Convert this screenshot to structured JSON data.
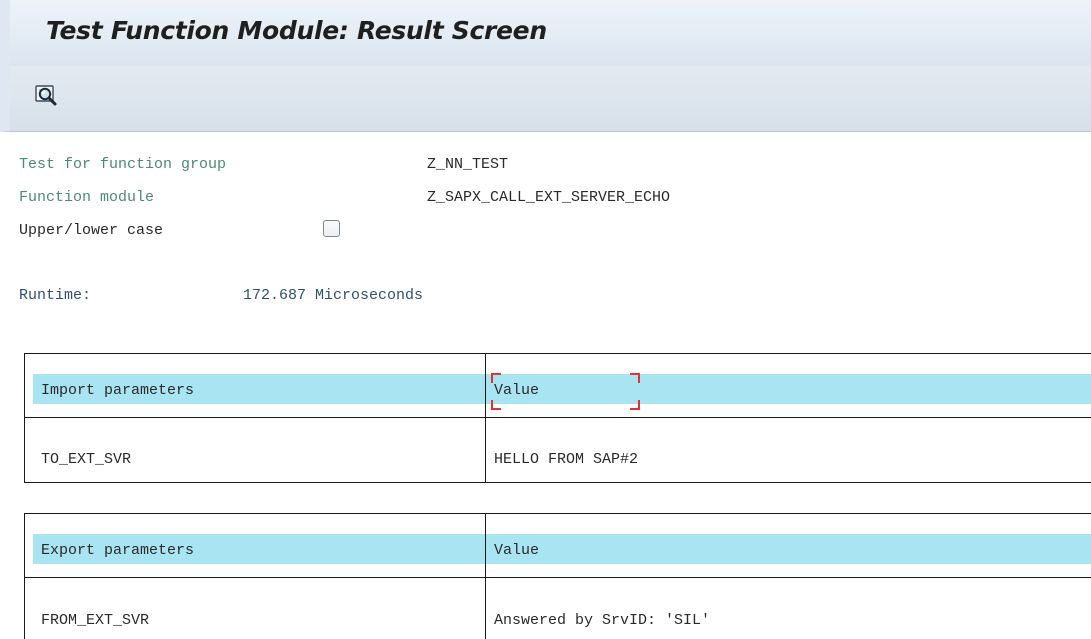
{
  "window": {
    "title": "Test Function Module: Result Screen"
  },
  "toolbar": {
    "buttons": [
      {
        "icon": "find-icon",
        "tooltip": ""
      }
    ]
  },
  "header": {
    "function_group_label": "Test for function group",
    "function_group_value": "Z_NN_TEST",
    "function_module_label": "Function module",
    "function_module_value": "Z_SAPX_CALL_EXT_SERVER_ECHO",
    "case_label": "Upper/lower case",
    "case_checked": false,
    "runtime_label": "Runtime:",
    "runtime_value": "172.687 Microseconds"
  },
  "import_table": {
    "col_param": "Import parameters",
    "col_value": "Value",
    "rows": [
      {
        "param": "TO_EXT_SVR",
        "value": "HELLO FROM SAP#2"
      }
    ]
  },
  "export_table": {
    "col_param": "Export parameters",
    "col_value": "Value",
    "rows": [
      {
        "param": "FROM_EXT_SVR",
        "value": "Answered by SrvID: 'SIL'"
      }
    ]
  },
  "colors": {
    "label_green": "#4d8a73",
    "runtime_blue": "#2f4f7a",
    "header_highlight": "#a9e4f3",
    "focus_red": "#e23232"
  }
}
